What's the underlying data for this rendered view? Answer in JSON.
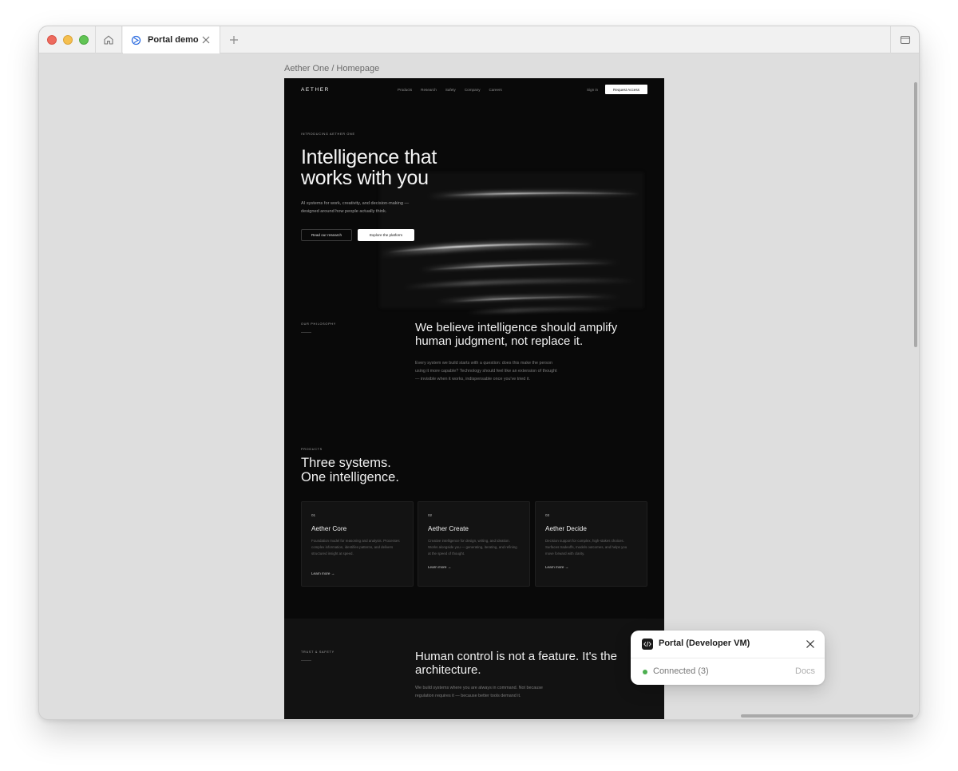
{
  "browser": {
    "tab_title": "Portal demo",
    "breadcrumb": "Aether One / Homepage"
  },
  "site": {
    "logo": "AETHER",
    "nav_links": [
      "Products",
      "Research",
      "Safety",
      "Company",
      "Careers"
    ],
    "sign_in": "Sign in",
    "cta": "Request Access",
    "hero": {
      "eyebrow": "INTRODUCING AETHER ONE",
      "title_line1": "Intelligence that",
      "title_line2": "works with you",
      "subtitle_line1": "AI systems for work, creativity, and decision-making —",
      "subtitle_line2": "designed around how people actually think.",
      "btn_secondary": "Read our research",
      "btn_primary": "Explore the platform"
    },
    "philosophy": {
      "eyebrow": "OUR PHILOSOPHY",
      "heading_line1": "We believe intelligence should amplify",
      "heading_line2": "human judgment, not replace it.",
      "body_line1": "Every system we build starts with a question: does this make the person",
      "body_line2": "using it more capable? Technology should feel like an extension of thought",
      "body_line3": "— invisible when it works, indispensable once you've tried it."
    },
    "products": {
      "eyebrow": "PRODUCTS",
      "title_line1": "Three systems.",
      "title_line2": "One intelligence.",
      "cards": [
        {
          "num": "01",
          "title": "Aether Core",
          "desc": "Foundation model for reasoning and analysis. Processes complex information, identifies patterns, and delivers structured insight at speed.",
          "link": "Learn more →"
        },
        {
          "num": "02",
          "title": "Aether Create",
          "desc": "Creative intelligence for design, writing, and ideation. Works alongside you — generating, iterating, and refining at the speed of thought.",
          "link": "Learn more →"
        },
        {
          "num": "03",
          "title": "Aether Decide",
          "desc": "Decision support for complex, high-stakes choices. Surfaces tradeoffs, models outcomes, and helps you move forward with clarity.",
          "link": "Learn more →"
        }
      ]
    },
    "trust": {
      "eyebrow": "TRUST & SAFETY",
      "heading_line1": "Human control is not a feature. It's the",
      "heading_line2": "architecture.",
      "body_line1": "We build systems where you are always in command. Not because",
      "body_line2": "regulation requires it — because better tools demand it."
    }
  },
  "portal": {
    "title": "Portal (Developer VM)",
    "status": "Connected (3)",
    "docs": "Docs",
    "status_color": "#4caf50"
  }
}
